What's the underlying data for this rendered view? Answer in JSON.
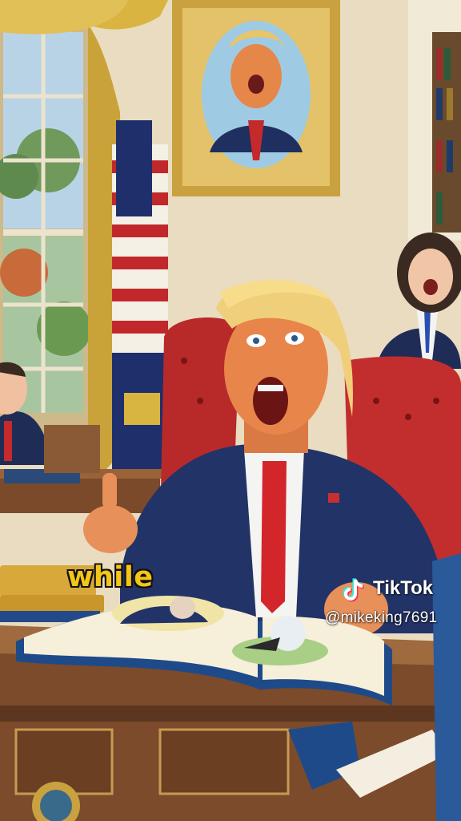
{
  "caption": {
    "text": "while"
  },
  "watermark": {
    "brand": "TikTok",
    "handle": "@mikeking7691",
    "logo_icon": "tiktok-note-icon"
  },
  "colors": {
    "caption_fill": "#f5c518",
    "caption_outline": "#111111",
    "watermark_text": "#ffffff",
    "tiktok_cyan": "#25f4ee",
    "tiktok_red": "#fe2c55"
  }
}
